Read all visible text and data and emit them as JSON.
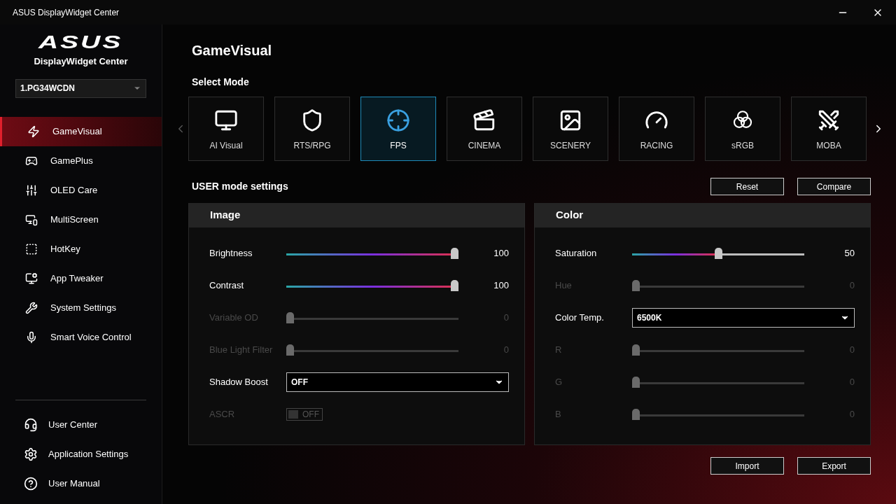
{
  "window": {
    "title": "ASUS DisplayWidget Center"
  },
  "sidebar": {
    "logo": "ASUS",
    "app_name": "DisplayWidget Center",
    "monitor": "1.PG34WCDN",
    "items": [
      {
        "label": "GameVisual",
        "selected": true
      },
      {
        "label": "GamePlus",
        "selected": false
      },
      {
        "label": "OLED Care",
        "selected": false
      },
      {
        "label": "MultiScreen",
        "selected": false
      },
      {
        "label": "HotKey",
        "selected": false
      },
      {
        "label": "App Tweaker",
        "selected": false
      },
      {
        "label": "System Settings",
        "selected": false
      },
      {
        "label": "Smart Voice Control",
        "selected": false
      }
    ],
    "bottom_items": [
      {
        "label": "User Center"
      },
      {
        "label": "Application Settings"
      },
      {
        "label": "User Manual"
      }
    ]
  },
  "page_title": "GameVisual",
  "select_mode": {
    "heading": "Select Mode",
    "modes": [
      {
        "label": "AI Visual",
        "selected": false
      },
      {
        "label": "RTS/RPG",
        "selected": false
      },
      {
        "label": "FPS",
        "selected": true
      },
      {
        "label": "CINEMA",
        "selected": false
      },
      {
        "label": "SCENERY",
        "selected": false
      },
      {
        "label": "RACING",
        "selected": false
      },
      {
        "label": "sRGB",
        "selected": false
      },
      {
        "label": "MOBA",
        "selected": false
      }
    ]
  },
  "user_settings": {
    "heading": "USER mode settings",
    "buttons": [
      "Reset",
      "Compare"
    ]
  },
  "panels": [
    {
      "title": "Image",
      "rows": [
        {
          "kind": "slider",
          "label": "Brightness",
          "level": 1,
          "reading": "100",
          "disabled": false
        },
        {
          "kind": "slider",
          "label": "Contrast",
          "level": 1,
          "reading": "100",
          "disabled": false
        },
        {
          "kind": "slider",
          "label": "Variable OD",
          "level": 0,
          "reading": "0",
          "disabled": true
        },
        {
          "kind": "slider",
          "label": "Blue Light Filter",
          "level": 0,
          "reading": "0",
          "disabled": true
        },
        {
          "kind": "dropdown",
          "label": "Shadow Boost",
          "value": "OFF",
          "disabled": false
        },
        {
          "kind": "toggle",
          "label": "ASCR",
          "value": "OFF",
          "on": false,
          "disabled": true
        }
      ]
    },
    {
      "title": "Color",
      "rows": [
        {
          "kind": "slider",
          "label": "Saturation",
          "level": 0.5,
          "reading": "50",
          "disabled": false
        },
        {
          "kind": "slider",
          "label": "Hue",
          "level": 0,
          "reading": "0",
          "disabled": true
        },
        {
          "kind": "dropdown",
          "label": "Color Temp.",
          "value": "6500K",
          "disabled": false
        },
        {
          "kind": "slider",
          "label": "R",
          "level": 0,
          "reading": "0",
          "disabled": true
        },
        {
          "kind": "slider",
          "label": "G",
          "level": 0,
          "reading": "0",
          "disabled": true
        },
        {
          "kind": "slider",
          "label": "B",
          "level": 0,
          "reading": "0",
          "disabled": true
        }
      ]
    }
  ],
  "footer_buttons": [
    "Import",
    "Export"
  ]
}
